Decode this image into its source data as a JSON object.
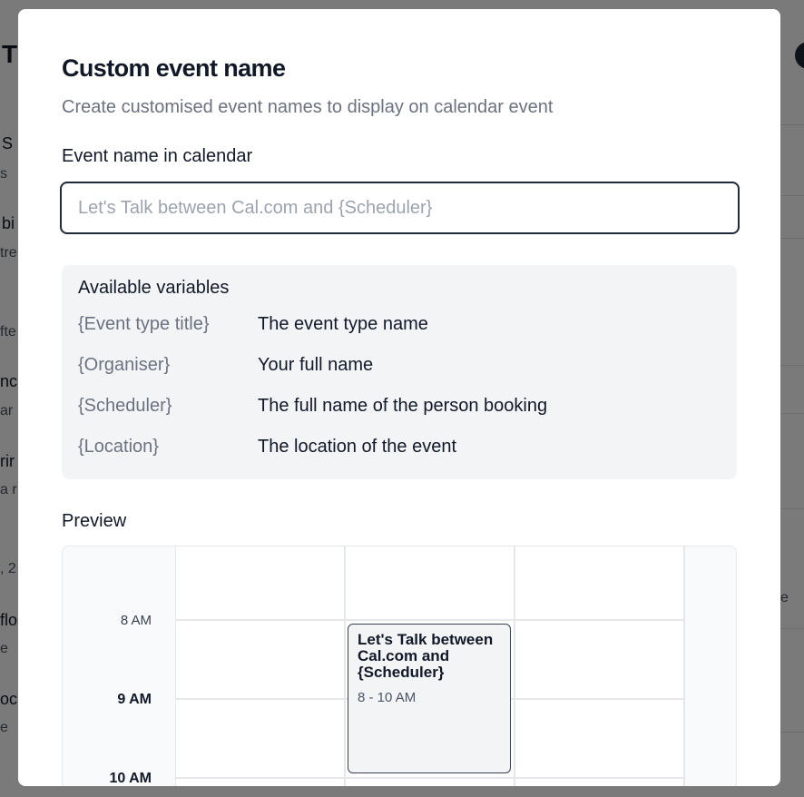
{
  "background": {
    "title_fragment": "T",
    "rows": [
      {
        "label": "S",
        "sub": "s"
      },
      {
        "label": "bi",
        "sub": "tre"
      },
      {
        "label": "",
        "sub": "fte"
      },
      {
        "label": "nc",
        "sub": "ar"
      },
      {
        "label": "rir",
        "sub": "a r"
      },
      {
        "label": "",
        "sub": ", 2"
      },
      {
        "label": "flo",
        "sub": "e"
      },
      {
        "label": "oc",
        "sub": "e"
      }
    ],
    "right_fragment": "e"
  },
  "modal": {
    "title": "Custom event name",
    "subtitle": "Create customised event names to display on calendar event",
    "field_label": "Event name in calendar",
    "input": {
      "value": "",
      "placeholder": "Let's Talk between Cal.com and {Scheduler}"
    },
    "variables": {
      "heading": "Available variables",
      "items": [
        {
          "key": "{Event type title}",
          "desc": "The event type name"
        },
        {
          "key": "{Organiser}",
          "desc": "Your full name"
        },
        {
          "key": "{Scheduler}",
          "desc": "The full name of the person booking"
        },
        {
          "key": "{Location}",
          "desc": "The location of the event"
        }
      ]
    },
    "preview": {
      "label": "Preview",
      "times": [
        "8 AM",
        "9 AM",
        "10 AM"
      ],
      "event": {
        "title": "Let's Talk between Cal.com and {Scheduler}",
        "time": "8 - 10 AM"
      }
    }
  },
  "colors": {
    "accent": "#1f2937",
    "muted_text": "#6b7280",
    "panel_bg": "#f3f4f6"
  }
}
